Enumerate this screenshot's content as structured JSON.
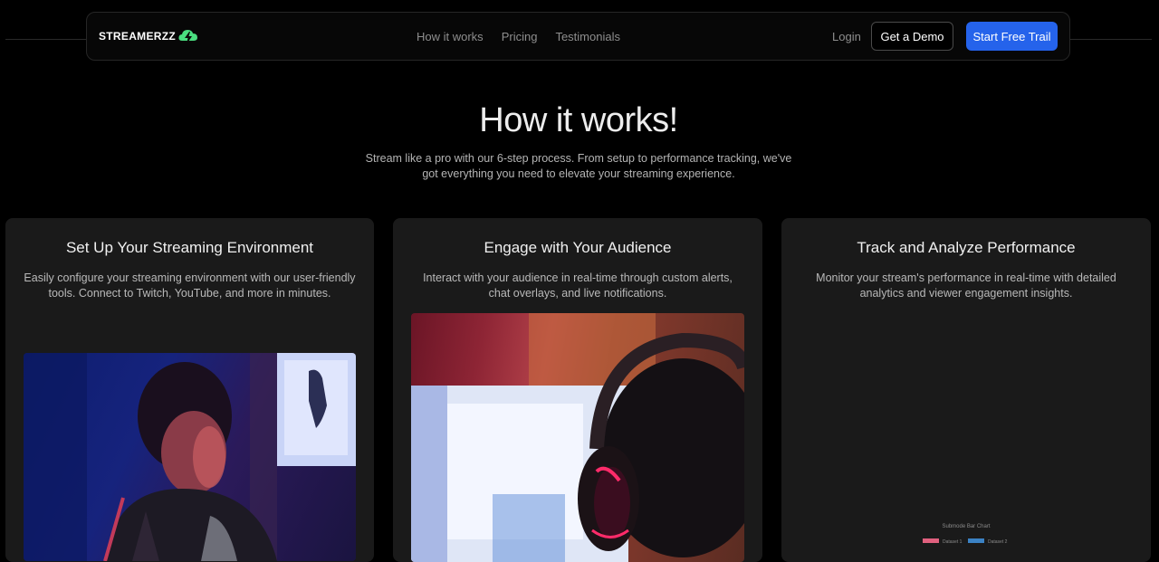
{
  "nav": {
    "logo_text": "STREAMERZZ",
    "links": [
      "How it works",
      "Pricing",
      "Testimonials"
    ],
    "login": "Login",
    "demo_button": "Get a Demo",
    "trial_button": "Start Free Trail"
  },
  "hero": {
    "title": "How it works!",
    "subtitle": "Stream like a pro with our 6-step process. From setup to performance tracking, we've got everything you need to elevate your streaming experience."
  },
  "cards": [
    {
      "title": "Set Up Your Streaming Environment",
      "description": "Easily configure your streaming environment with our user-friendly tools. Connect to Twitch, YouTube, and more in minutes."
    },
    {
      "title": "Engage with Your Audience",
      "description": "Interact with your audience in real-time through custom alerts, chat overlays, and live notifications."
    },
    {
      "title": "Track and Analyze Performance",
      "description": "Monitor your stream's performance in real-time with detailed analytics and viewer engagement insights."
    }
  ],
  "chart_data": {
    "type": "bar",
    "title": "Submode Bar Chart",
    "series": [
      {
        "name": "Dataset 1",
        "values": []
      },
      {
        "name": "Dataset 2",
        "values": []
      }
    ],
    "colors": [
      "#e0607e",
      "#3b82c4"
    ],
    "legend": "top"
  },
  "colors": {
    "accent": "#2563eb",
    "logo_green": "#4ade80",
    "card_bg": "#1a1a1a"
  }
}
